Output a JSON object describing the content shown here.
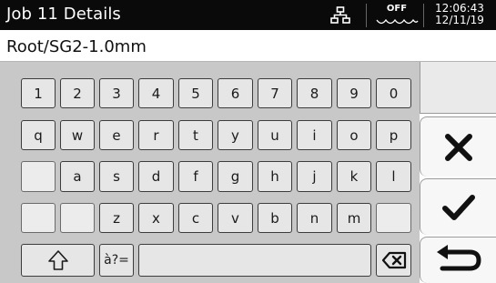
{
  "header": {
    "title": "Job 11 Details",
    "sonar_status": "OFF",
    "time": "12:06:43",
    "date": "12/11/19",
    "icons": [
      "network-icon",
      "sonar-wave-icon"
    ]
  },
  "path": {
    "value": "Root/SG2-1.0mm"
  },
  "keyboard": {
    "row1": [
      "1",
      "2",
      "3",
      "4",
      "5",
      "6",
      "7",
      "8",
      "9",
      "0"
    ],
    "row2": [
      "q",
      "w",
      "e",
      "r",
      "t",
      "y",
      "u",
      "i",
      "o",
      "p"
    ],
    "row3": [
      "a",
      "s",
      "d",
      "f",
      "g",
      "h",
      "j",
      "k",
      "l"
    ],
    "row4": [
      "z",
      "x",
      "c",
      "v",
      "b",
      "n",
      "m"
    ],
    "symbols_label": "à?=",
    "shift_icon": "shift-arrow-icon",
    "backspace_icon": "backspace-icon"
  },
  "side_buttons": {
    "cancel_icon": "close-icon",
    "confirm_icon": "checkmark-icon",
    "back_icon": "return-arrow-icon"
  },
  "colors": {
    "titlebar": "#0a0a0a",
    "keyboard_bg": "#c8c8c8",
    "key_bg": "#e6e6e6"
  }
}
